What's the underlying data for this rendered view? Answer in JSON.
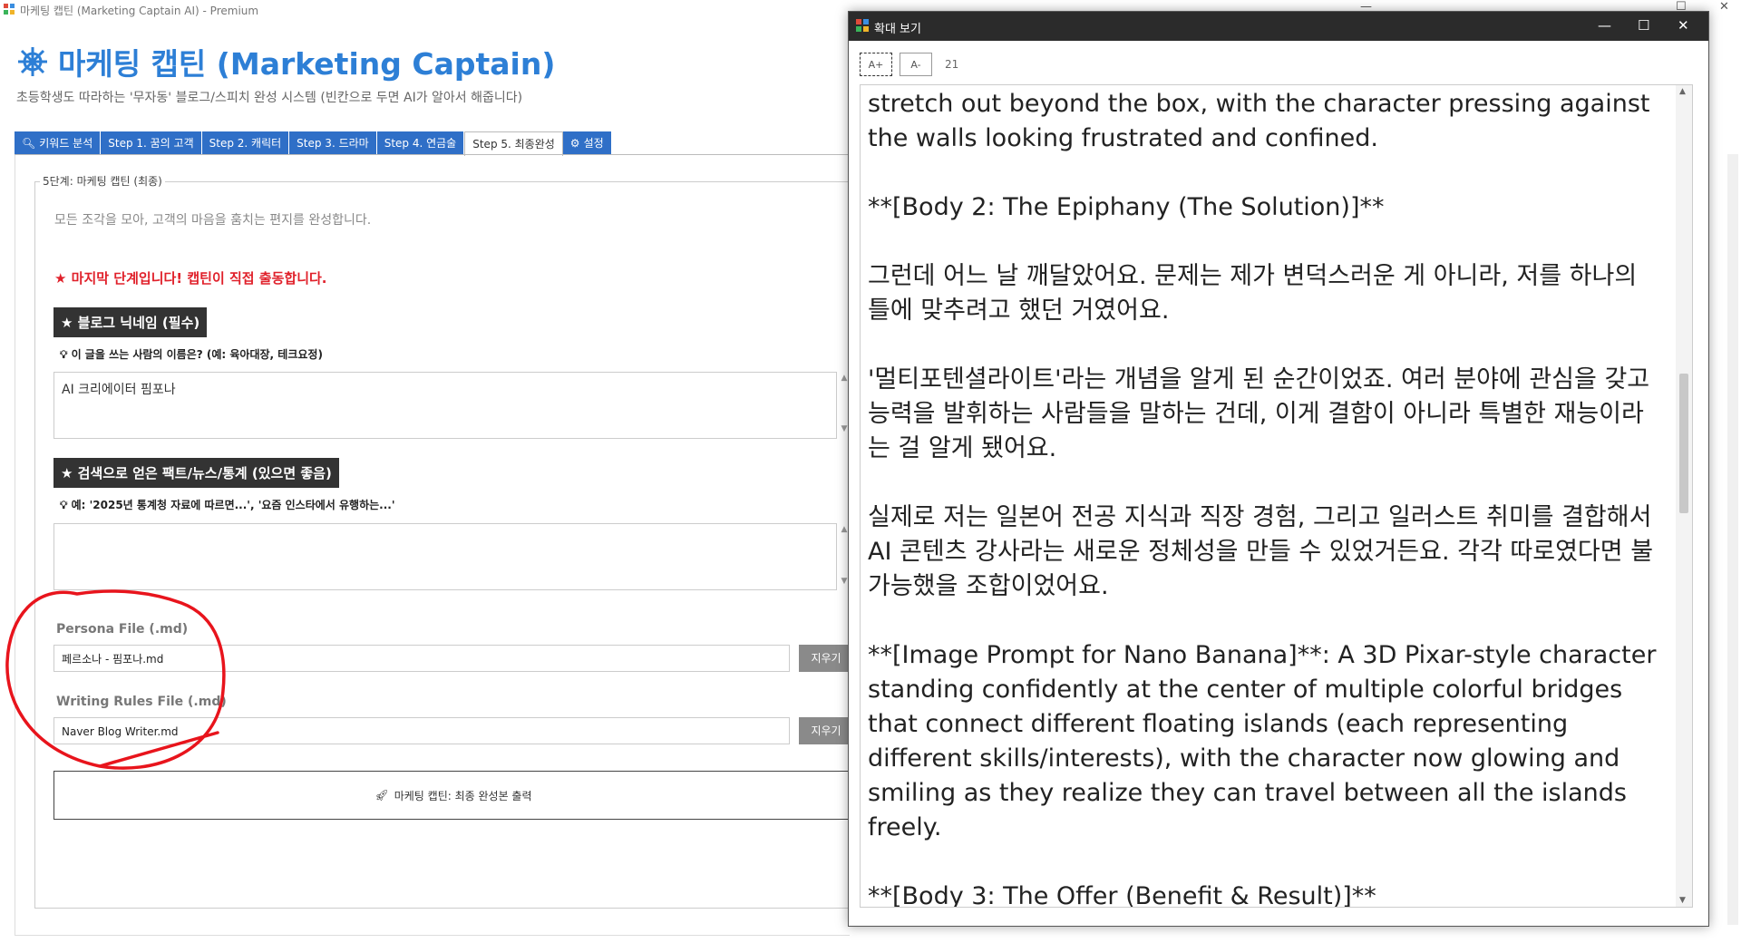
{
  "window": {
    "title": "마케팅 캡틴 (Marketing Captain AI) - Premium",
    "minimize": "—",
    "maximize": "☐",
    "close": "✕"
  },
  "header": {
    "title": "마케팅 캡틴 (Marketing Captain)",
    "subtitle": "초등학생도 따라하는 '무자동' 블로그/스피치 완성 시스템 (빈칸으로 두면 AI가 알아서 해줍니다)"
  },
  "tabs": [
    {
      "label": "키워드 분석",
      "icon": "search-icon"
    },
    {
      "label": "Step 1. 꿈의 고객"
    },
    {
      "label": "Step 2. 캐릭터"
    },
    {
      "label": "Step 3. 드라마"
    },
    {
      "label": "Step 4. 연금술"
    },
    {
      "label": "Step 5. 최종완성",
      "active": true
    },
    {
      "label": "설정",
      "icon": "gear-icon"
    }
  ],
  "step5": {
    "group_title": "5단계: 마케팅 캡틴 (최종)",
    "description": "모든 조각을 모아, 고객의 마음을 훔치는 편지를 완성합니다.",
    "final_note": "★ 마지막 단계입니다! 캡틴이 직접 출동합니다.",
    "nickname": {
      "label": "★ 블로그 닉네임 (필수)",
      "hint": "이 글을 쓰는 사람의 이름은? (예: 육아대장, 테크요정)",
      "value": "AI 크리에이터 핌포나"
    },
    "facts": {
      "label": "★ 검색으로 얻은 팩트/뉴스/통계 (있으면 좋음)",
      "hint": "예: '2025년 통계청 자료에 따르면...', '요즘 인스타에서 유행하는...'",
      "value": ""
    },
    "persona_file": {
      "label": "Persona File (.md)",
      "value": "페르소나 - 핌포나.md",
      "clear": "지우기"
    },
    "rules_file": {
      "label": "Writing Rules File (.md)",
      "value": "Naver Blog Writer.md",
      "clear": "지우기"
    },
    "output_button": "마케팅 캡틴: 최종 완성본 출력"
  },
  "zoom_window": {
    "title": "확대 보기",
    "btn_increase": "A+",
    "btn_decrease": "A-",
    "font_size": "21",
    "paragraphs": [
      "stretch out beyond the box, with the character pressing against the walls looking frustrated and confined.",
      "**[Body 2: The Epiphany (The Solution)]**",
      "그런데 어느 날 깨달았어요. 문제는 제가 변덕스러운 게 아니라, 저를 하나의 틀에 맞추려고 했던 거였어요.",
      "'멀티포텐셜라이트'라는 개념을 알게 된 순간이었죠. 여러 분야에 관심을 갖고 능력을 발휘하는 사람들을 말하는 건데, 이게 결함이 아니라 특별한 재능이라는 걸 알게 됐어요.",
      "실제로 저는 일본어 전공 지식과 직장 경험, 그리고 일러스트 취미를 결합해서 AI 콘텐츠 강사라는 새로운 정체성을 만들 수 있었거든요. 각각 따로였다면 불가능했을 조합이었어요.",
      "**[Image Prompt for Nano Banana]**: A 3D Pixar-style character standing confidently at the center of multiple colorful bridges that connect different floating islands (each representing different skills/interests), with the character now glowing and smiling as they realize they can travel between all the islands freely.",
      "**[Body 3: The Offer (Benefit & Result)]**"
    ],
    "scroll_position": 0.42
  },
  "colors": {
    "accent": "#2d7fd6",
    "tab_bg": "#2f6fc7",
    "warning": "#e0202a",
    "annotation": "#e8141c"
  }
}
